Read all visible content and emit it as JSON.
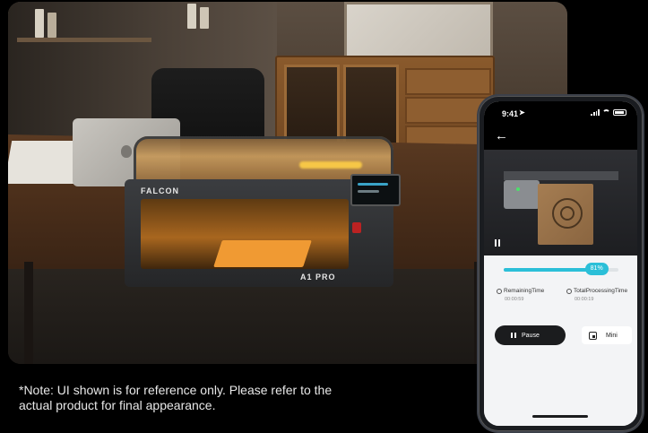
{
  "note": {
    "line1": "*Note: UI shown is for reference only. Please refer to the",
    "line2": "actual product for final appearance."
  },
  "machine": {
    "brand": "FALCON",
    "model": "A1 PRO"
  },
  "phone": {
    "status_time": "9:41",
    "status_icons": [
      "signal-icon",
      "wifi-icon",
      "battery-icon"
    ],
    "back_icon": "back-arrow-icon",
    "camera_overlay_icon": "pause-icon",
    "progress": {
      "percent": 81,
      "label": "81%"
    },
    "stats": [
      {
        "label": "RemainingTime",
        "value": "00:00:59",
        "icon": "clock-icon"
      },
      {
        "label": "TotalProcessingTime",
        "value": "00:00:19",
        "icon": "clock-icon"
      }
    ],
    "buttons": {
      "pause_label": "Pause",
      "mini_label": "Mini"
    }
  },
  "colors": {
    "accent": "#2bbfd8",
    "button_dark": "#1b1c1e",
    "panel_bg": "#f3f4f6"
  }
}
